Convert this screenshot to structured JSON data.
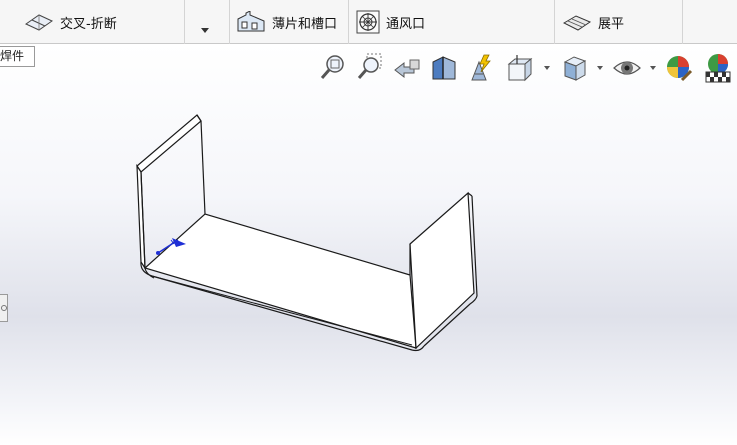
{
  "ribbon": {
    "intersect_bend": {
      "label": "交叉-折断",
      "icon": "intersect-bend-icon"
    },
    "tab_and_slot": {
      "label": "薄片和槽口",
      "icon": "tab-and-slot-icon"
    },
    "vent": {
      "label": "通风口",
      "icon": "vent-icon"
    },
    "unfold": {
      "label": "展平",
      "icon": "flatten-icon"
    }
  },
  "feature_tree_tab": {
    "label": "焊件"
  },
  "heads_up_toolbar": {
    "icons": [
      "zoom-to-fit-icon",
      "zoom-to-area-icon",
      "previous-view-icon",
      "section-view-icon",
      "dynamic-annotation-icon",
      "view-orientation-icon",
      "display-style-icon",
      "hide-show-icon",
      "edit-appearance-icon",
      "apply-scene-icon"
    ]
  },
  "colors": {
    "ribbon_bg": "#f6f6f6",
    "model_edge": "#1a1a1a",
    "triad_blue": "#1f2fd6"
  }
}
